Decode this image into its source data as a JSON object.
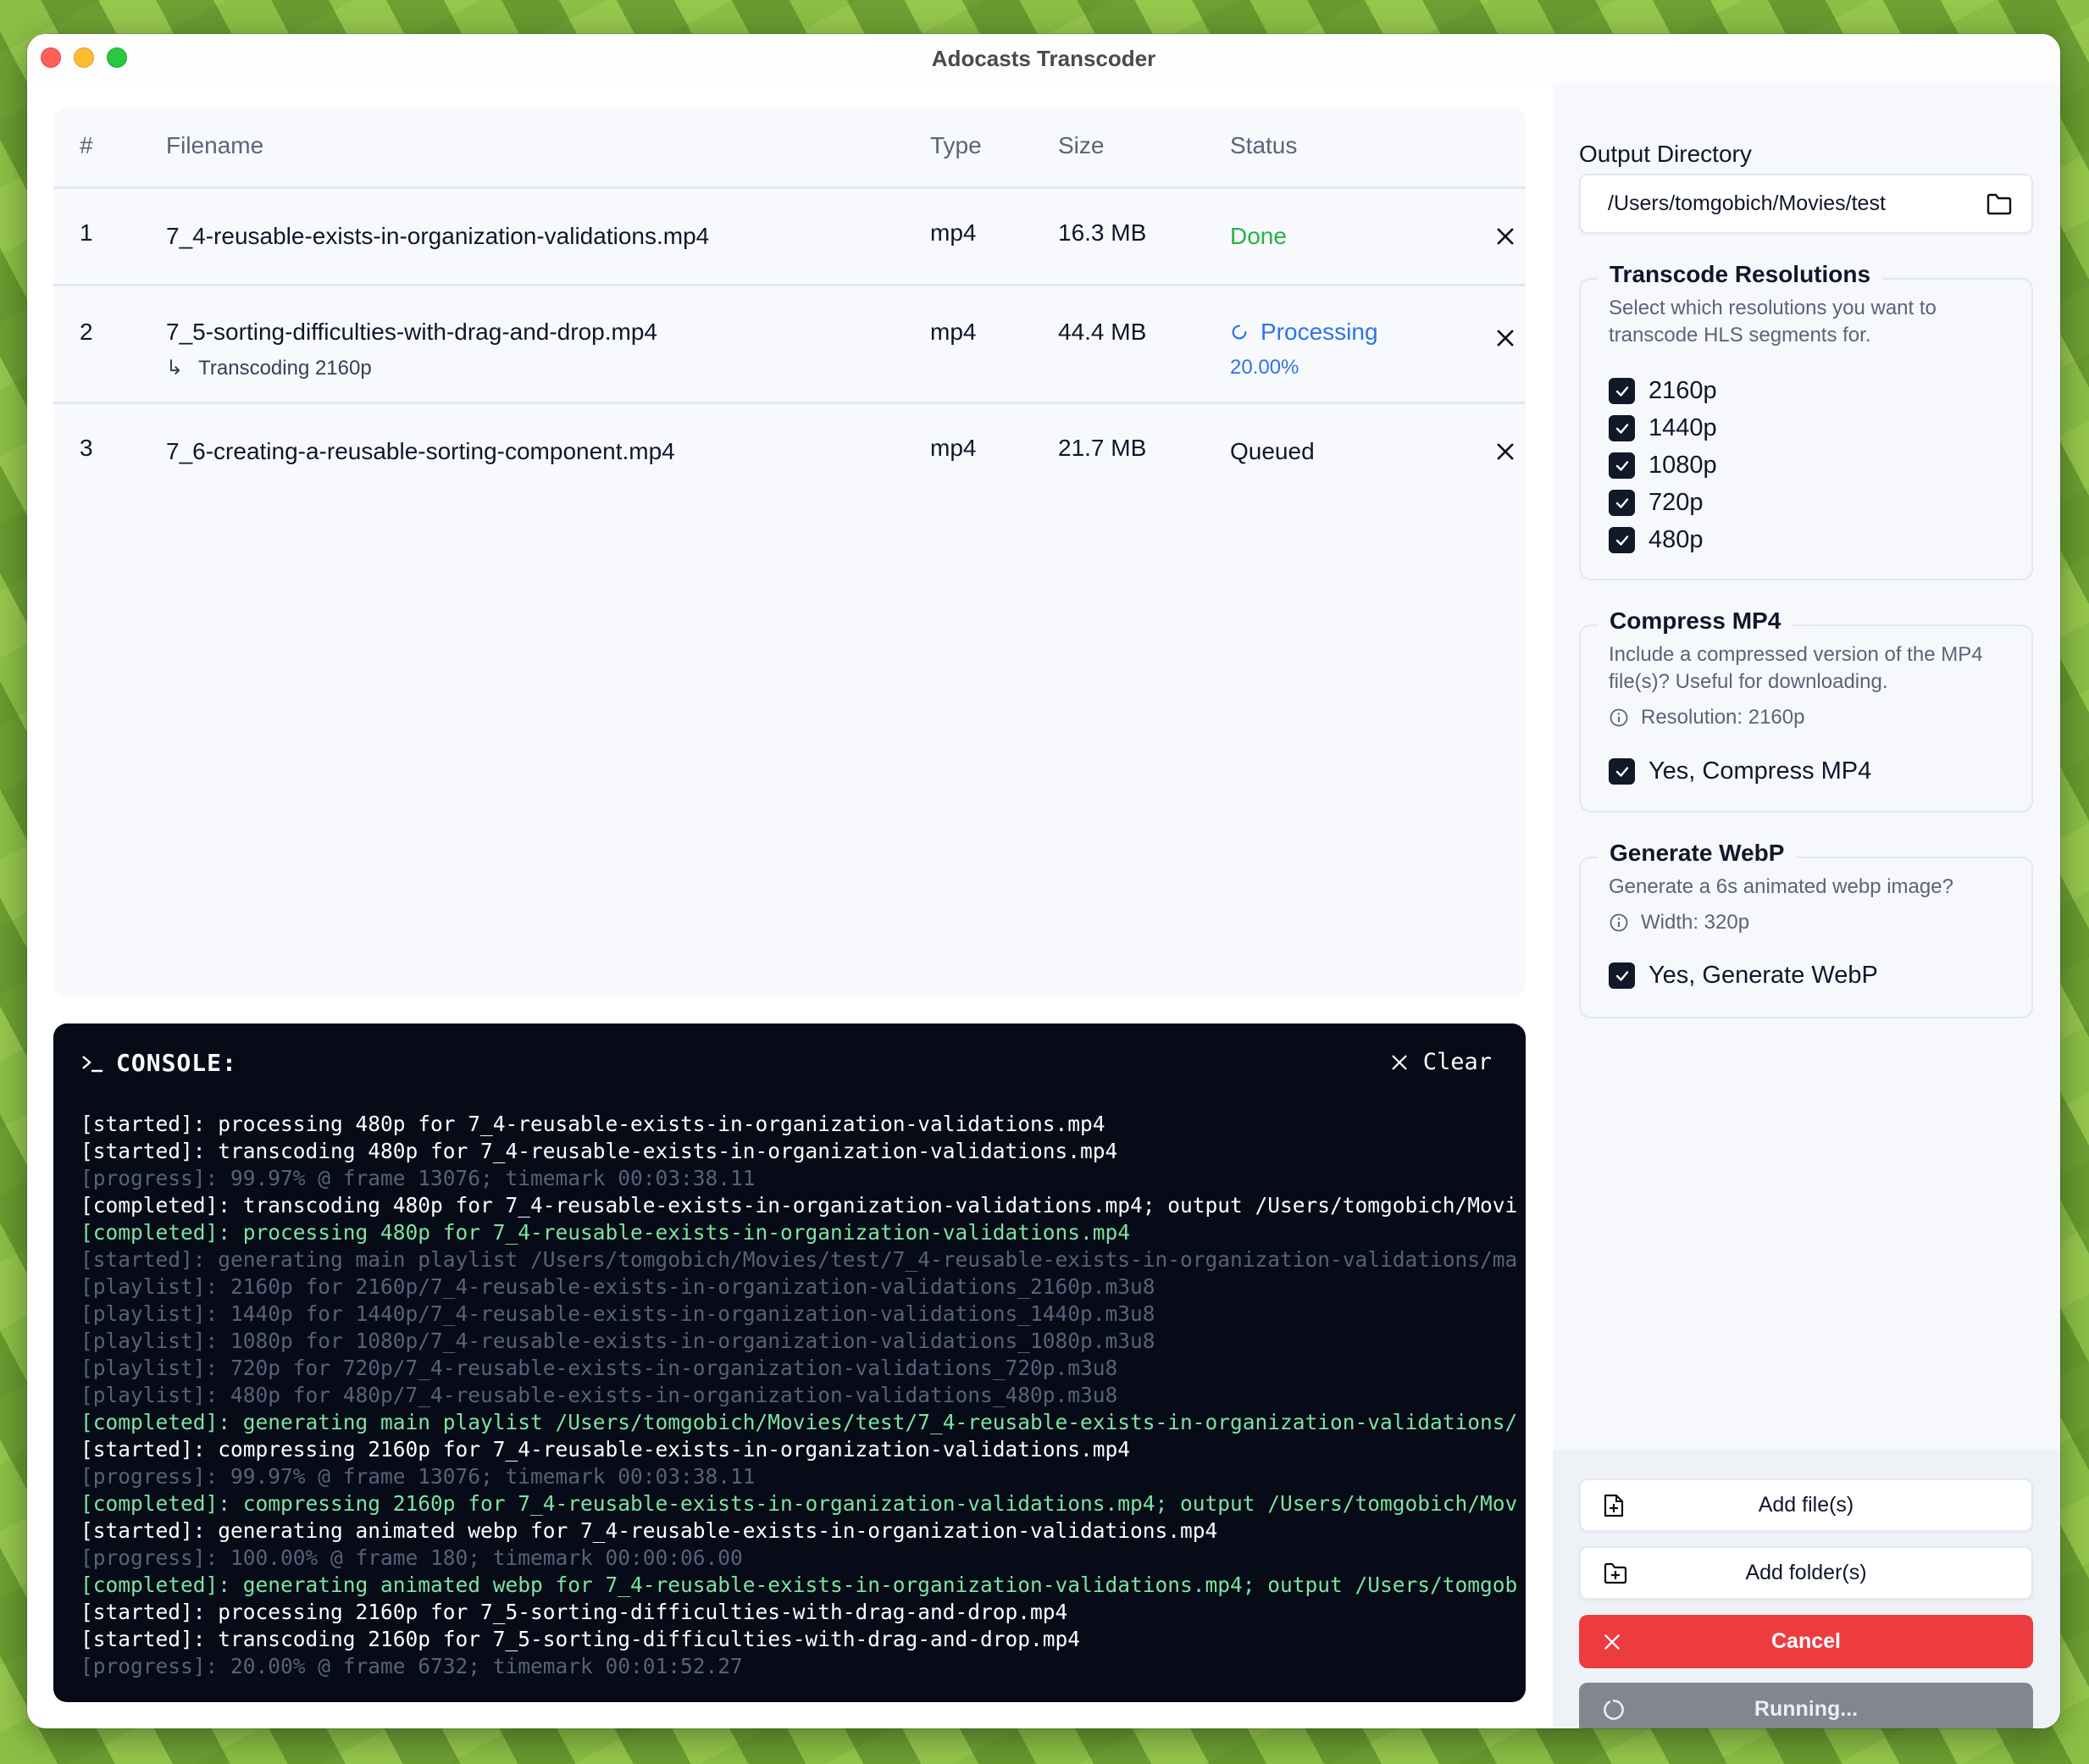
{
  "window": {
    "title": "Adocasts Transcoder"
  },
  "table": {
    "headers": {
      "num": "#",
      "filename": "Filename",
      "type": "Type",
      "size": "Size",
      "status": "Status"
    },
    "rows": [
      {
        "num": "1",
        "filename": "7_4-reusable-exists-in-organization-validations.mp4",
        "type": "mp4",
        "size": "16.3 MB",
        "status": "Done"
      },
      {
        "num": "2",
        "filename": "7_5-sorting-difficulties-with-drag-and-drop.mp4",
        "subtask": "Transcoding 2160p",
        "type": "mp4",
        "size": "44.4 MB",
        "status": "Processing",
        "progress": "20.00%"
      },
      {
        "num": "3",
        "filename": "7_6-creating-a-reusable-sorting-component.mp4",
        "type": "mp4",
        "size": "21.7 MB",
        "status": "Queued"
      }
    ]
  },
  "console": {
    "title": "CONSOLE:",
    "clear_label": "Clear",
    "lines": [
      {
        "kind": "started",
        "text": "[started]: processing 480p for 7_4-reusable-exists-in-organization-validations.mp4"
      },
      {
        "kind": "started",
        "text": "[started]: transcoding 480p for 7_4-reusable-exists-in-organization-validations.mp4"
      },
      {
        "kind": "progress",
        "text": "[progress]: 99.97% @ frame 13076; timemark 00:03:38.11"
      },
      {
        "kind": "completed-white",
        "text": "[completed]: transcoding 480p for 7_4-reusable-exists-in-organization-validations.mp4; output /Users/tomgobich/Movi"
      },
      {
        "kind": "completed",
        "text": "[completed]: processing 480p for 7_4-reusable-exists-in-organization-validations.mp4"
      },
      {
        "kind": "dim",
        "text": "[started]: generating main playlist /Users/tomgobich/Movies/test/7_4-reusable-exists-in-organization-validations/ma"
      },
      {
        "kind": "dim",
        "text": "[playlist]: 2160p for 2160p/7_4-reusable-exists-in-organization-validations_2160p.m3u8"
      },
      {
        "kind": "dim",
        "text": "[playlist]: 1440p for 1440p/7_4-reusable-exists-in-organization-validations_1440p.m3u8"
      },
      {
        "kind": "dim",
        "text": "[playlist]: 1080p for 1080p/7_4-reusable-exists-in-organization-validations_1080p.m3u8"
      },
      {
        "kind": "dim",
        "text": "[playlist]: 720p for 720p/7_4-reusable-exists-in-organization-validations_720p.m3u8"
      },
      {
        "kind": "dim",
        "text": "[playlist]: 480p for 480p/7_4-reusable-exists-in-organization-validations_480p.m3u8"
      },
      {
        "kind": "completed",
        "text": "[completed]: generating main playlist /Users/tomgobich/Movies/test/7_4-reusable-exists-in-organization-validations/"
      },
      {
        "kind": "started",
        "text": "[started]: compressing 2160p for 7_4-reusable-exists-in-organization-validations.mp4"
      },
      {
        "kind": "progress",
        "text": "[progress]: 99.97% @ frame 13076; timemark 00:03:38.11"
      },
      {
        "kind": "completed",
        "text": "[completed]: compressing 2160p for 7_4-reusable-exists-in-organization-validations.mp4; output /Users/tomgobich/Mov"
      },
      {
        "kind": "started",
        "text": "[started]: generating animated webp for 7_4-reusable-exists-in-organization-validations.mp4"
      },
      {
        "kind": "progress",
        "text": "[progress]: 100.00% @ frame 180; timemark 00:00:06.00"
      },
      {
        "kind": "completed",
        "text": "[completed]: generating animated webp for 7_4-reusable-exists-in-organization-validations.mp4; output /Users/tomgob"
      },
      {
        "kind": "started",
        "text": "[started]: processing 2160p for 7_5-sorting-difficulties-with-drag-and-drop.mp4"
      },
      {
        "kind": "started",
        "text": "[started]: transcoding 2160p for 7_5-sorting-difficulties-with-drag-and-drop.mp4"
      },
      {
        "kind": "progress",
        "text": "[progress]: 20.00% @ frame 6732; timemark 00:01:52.27"
      }
    ]
  },
  "sidebar": {
    "output_directory": {
      "label": "Output Directory",
      "value": "/Users/tomgobich/Movies/test"
    },
    "transcode_resolutions": {
      "legend": "Transcode Resolutions",
      "description": "Select which resolutions you want to transcode HLS segments for.",
      "options": [
        {
          "label": "2160p",
          "checked": true
        },
        {
          "label": "1440p",
          "checked": true
        },
        {
          "label": "1080p",
          "checked": true
        },
        {
          "label": "720p",
          "checked": true
        },
        {
          "label": "480p",
          "checked": true
        }
      ]
    },
    "compress_mp4": {
      "legend": "Compress MP4",
      "description": "Include a compressed version of the MP4 file(s)? Useful for downloading.",
      "info": "Resolution: 2160p",
      "checkbox_label": "Yes, Compress MP4",
      "checked": true
    },
    "generate_webp": {
      "legend": "Generate WebP",
      "description": "Generate a 6s animated webp image?",
      "info": "Width: 320p",
      "checkbox_label": "Yes, Generate WebP",
      "checked": true
    },
    "buttons": {
      "add_files": "Add file(s)",
      "add_folders": "Add folder(s)",
      "cancel": "Cancel",
      "running": "Running..."
    }
  },
  "colors": {
    "done": "#22b34c",
    "processing": "#2f74e6",
    "cancel": "#ec3c3f",
    "running": "#82868f",
    "console_bg": "#060b17",
    "console_completed": "#7ee3a0"
  }
}
